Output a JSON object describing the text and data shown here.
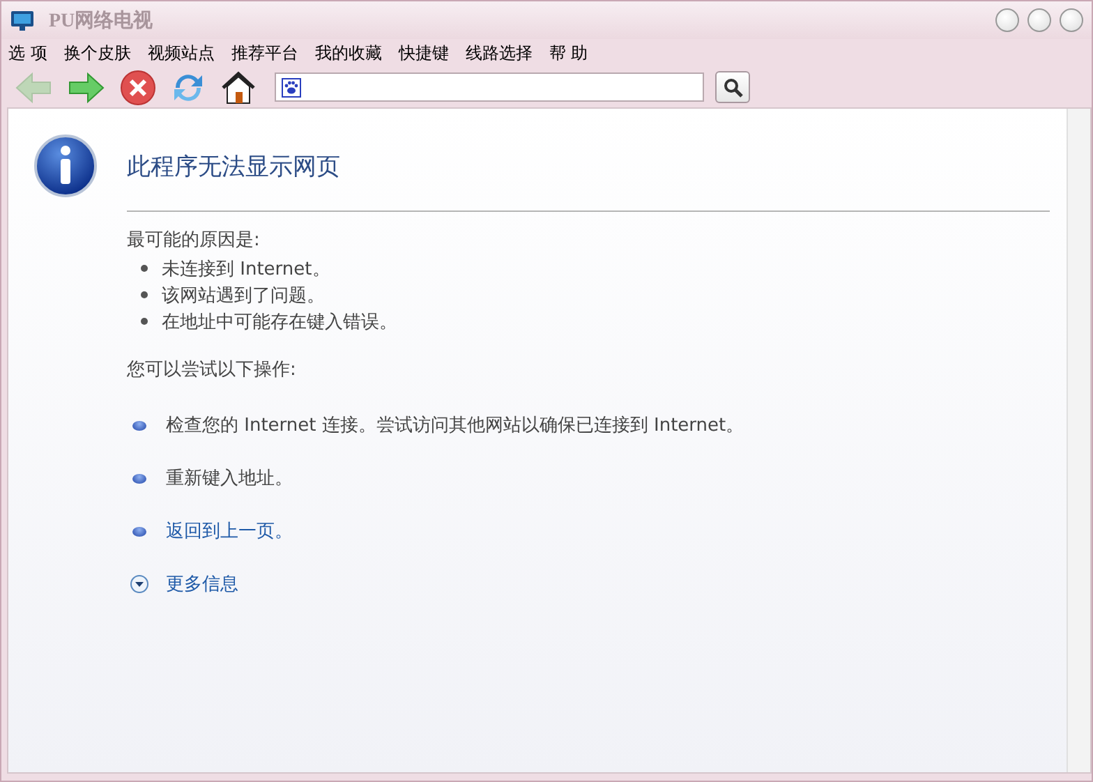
{
  "window": {
    "title": "PU网络电视"
  },
  "menu": [
    "选 项",
    "换个皮肤",
    "视频站点",
    "推荐平台",
    "我的收藏",
    "快捷键",
    "线路选择",
    "帮 助"
  ],
  "toolbar": [
    {
      "kind": "back",
      "disabled": true
    },
    {
      "kind": "forward",
      "disabled": false
    },
    {
      "kind": "stop",
      "disabled": false
    },
    {
      "kind": "refresh",
      "disabled": false
    },
    {
      "kind": "home",
      "disabled": false
    }
  ],
  "error_page": {
    "title": "此程序无法显示网页",
    "causes_heading": "最可能的原因是:",
    "causes": [
      "未连接到 Internet。",
      "该网站遇到了问题。",
      "在地址中可能存在键入错误。"
    ],
    "actions_heading": "您可以尝试以下操作:",
    "actions": [
      {
        "kind": "text",
        "text": "检查您的 Internet 连接。尝试访问其他网站以确保已连接到 Internet。"
      },
      {
        "kind": "text",
        "text": "重新键入地址。"
      },
      {
        "kind": "link",
        "text": "返回到上一页。"
      }
    ],
    "more_info": "更多信息"
  }
}
